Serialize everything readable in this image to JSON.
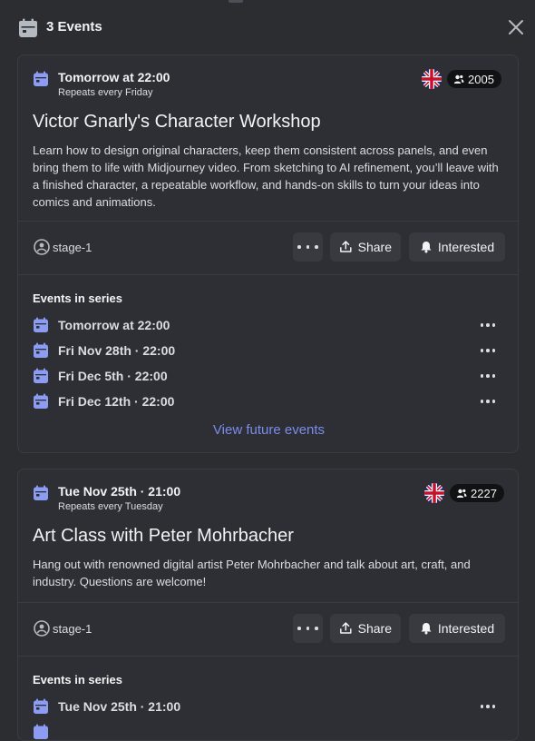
{
  "header": {
    "title": "3 Events",
    "icon": "calendar-icon"
  },
  "events": [
    {
      "when": "Tomorrow at 22:00",
      "repeat": "Repeats every Friday",
      "interested_count": "2005",
      "title": "Victor Gnarly's Character Workshop",
      "description": " Learn how to design original characters, keep them consistent across panels, and even bring them to life with Midjourney video. From sketching to AI refinement, you’ll leave with a finished character, a repeatable workflow, and hands-on skills to turn your ideas into comics and animations.",
      "location": "stage-1",
      "share_label": "Share",
      "interested_label": "Interested",
      "series_heading": "Events in series",
      "series": [
        "Tomorrow at 22:00",
        "Fri Nov 28th · 22:00",
        "Fri Dec 5th · 22:00",
        "Fri Dec 12th · 22:00"
      ],
      "view_future_label": "View future events"
    },
    {
      "when": "Tue Nov 25th · 21:00",
      "repeat": "Repeats every Tuesday",
      "interested_count": "2227",
      "title": "Art Class with Peter Mohrbacher",
      "description": "Hang out with renowned digital artist Peter Mohrbacher and talk about art, craft, and industry. Questions are welcome!",
      "location": "stage-1",
      "share_label": "Share",
      "interested_label": "Interested",
      "series_heading": "Events in series",
      "series": [
        "Tue Nov 25th · 21:00"
      ]
    }
  ],
  "colors": {
    "background": "#2b2d31",
    "card": "#2d2f34",
    "accent": "#7b8dea",
    "calendar_icon": "#8c9cf3",
    "pill": "#111214"
  }
}
